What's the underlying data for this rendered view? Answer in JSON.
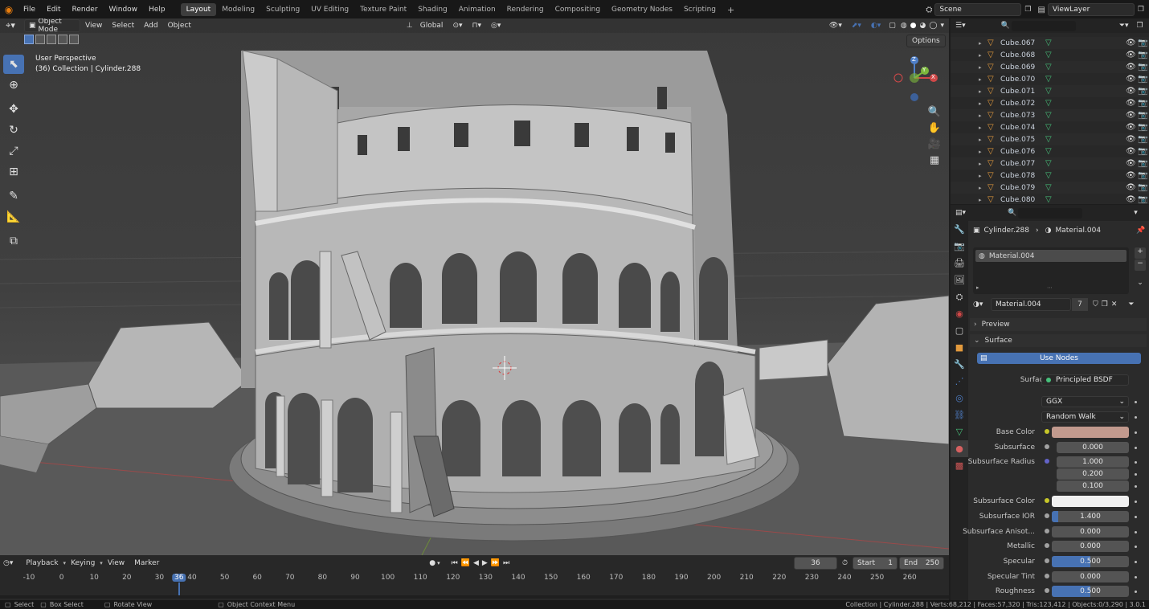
{
  "top_menu": [
    "File",
    "Edit",
    "Render",
    "Window",
    "Help"
  ],
  "workspaces": [
    "Layout",
    "Modeling",
    "Sculpting",
    "UV Editing",
    "Texture Paint",
    "Shading",
    "Animation",
    "Rendering",
    "Compositing",
    "Geometry Nodes",
    "Scripting"
  ],
  "active_workspace": "Layout",
  "add_workspace": "+",
  "scene_name": "Scene",
  "view_layer": "ViewLayer",
  "viewport": {
    "mode": "Object Mode",
    "menus": [
      "View",
      "Select",
      "Add",
      "Object"
    ],
    "transform_orientation": "Global",
    "options_label": "Options",
    "overlay_title": "User Perspective",
    "overlay_subtitle": "(36) Collection | Cylinder.288",
    "gizmo_x": "X",
    "gizmo_y": "Y",
    "gizmo_z": "Z"
  },
  "outliner": {
    "items": [
      "Cube.067",
      "Cube.068",
      "Cube.069",
      "Cube.070",
      "Cube.071",
      "Cube.072",
      "Cube.073",
      "Cube.074",
      "Cube.075",
      "Cube.076",
      "Cube.077",
      "Cube.078",
      "Cube.079",
      "Cube.080"
    ]
  },
  "properties": {
    "breadcrumb_object": "Cylinder.288",
    "breadcrumb_material": "Material.004",
    "slot_material": "Material.004",
    "material_name": "Material.004",
    "user_count": "7",
    "preview_label": "Preview",
    "surface_panel": "Surface",
    "use_nodes_label": "Use Nodes",
    "surface_label": "Surface",
    "surface_shader": "Principled BSDF",
    "distribution": "GGX",
    "subsurface_method": "Random Walk",
    "base_color_label": "Base Color",
    "base_color": "#c29a8e",
    "subsurface_label": "Subsurface",
    "subsurface_value": "0.000",
    "subsurface_radius_label": "Subsurface Radius",
    "subsurface_radius": [
      "1.000",
      "0.200",
      "0.100"
    ],
    "subsurface_color_label": "Subsurface Color",
    "subsurface_color": "#f0f0f0",
    "subsurface_ior_label": "Subsurface IOR",
    "subsurface_ior": "1.400",
    "subsurface_ior_fill": 0.08,
    "subsurface_aniso_label": "Subsurface Anisot...",
    "subsurface_aniso": "0.000",
    "metallic_label": "Metallic",
    "metallic": "0.000",
    "specular_label": "Specular",
    "specular": "0.500",
    "specular_fill": 0.5,
    "specular_tint_label": "Specular Tint",
    "specular_tint": "0.000",
    "roughness_label": "Roughness",
    "roughness": "0.500",
    "roughness_fill": 0.5
  },
  "timeline": {
    "menus": [
      "Playback",
      "Keying",
      "View",
      "Marker"
    ],
    "current_frame": "36",
    "start_label": "Start",
    "start": "1",
    "end_label": "End",
    "end": "250",
    "ruler": [
      "-10",
      "0",
      "10",
      "20",
      "30",
      "36",
      "40",
      "50",
      "60",
      "70",
      "80",
      "90",
      "100",
      "110",
      "120",
      "130",
      "140",
      "150",
      "160",
      "170",
      "180",
      "190",
      "200",
      "210",
      "220",
      "230",
      "240",
      "250",
      "260"
    ]
  },
  "statusbar": {
    "select": "Select",
    "box_select": "Box Select",
    "rotate_view": "Rotate View",
    "context_menu": "Object Context Menu",
    "stats": "Collection | Cylinder.288 | Verts:68,212 | Faces:57,320 | Tris:123,412 | Objects:0/3,290 | 3.0.1"
  },
  "colors": {
    "accent": "#4772b3",
    "object_icon": "#e39a3d",
    "mesh_icon": "#46c07a"
  }
}
